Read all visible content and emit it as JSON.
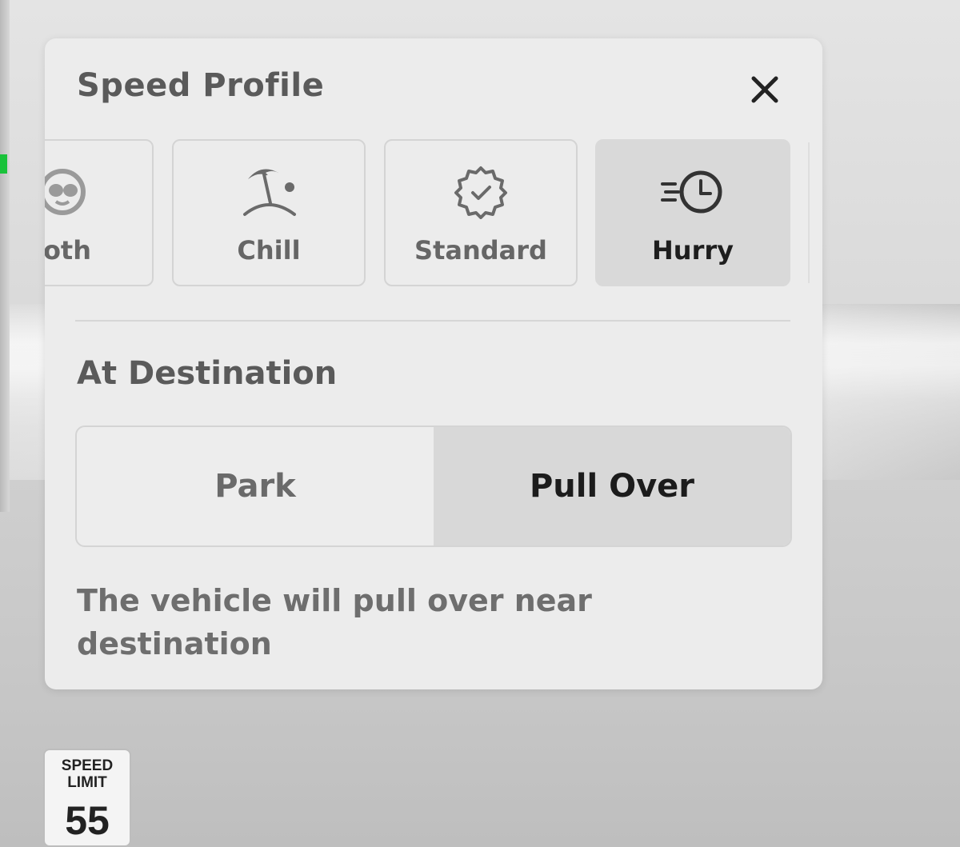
{
  "panel": {
    "title": "Speed Profile",
    "close_icon": "close-icon"
  },
  "speed_profiles": {
    "selected": "Hurry",
    "items": [
      {
        "label": "Sloth",
        "visible_label": "oth",
        "icon": "sloth-icon"
      },
      {
        "label": "Chill",
        "icon": "beach-umbrella-icon"
      },
      {
        "label": "Standard",
        "icon": "check-badge-icon"
      },
      {
        "label": "Hurry",
        "icon": "fast-clock-icon"
      }
    ]
  },
  "destination": {
    "title": "At Destination",
    "options": [
      "Park",
      "Pull Over"
    ],
    "selected": "Pull Over",
    "description": "The vehicle will pull over near destination"
  },
  "speed_limit": {
    "line1": "SPEED",
    "line2": "LIMIT",
    "value": "55"
  },
  "colors": {
    "panel_bg": "#ececec",
    "selected_bg": "#d9d9d9",
    "indicator_green": "#19c23a"
  }
}
